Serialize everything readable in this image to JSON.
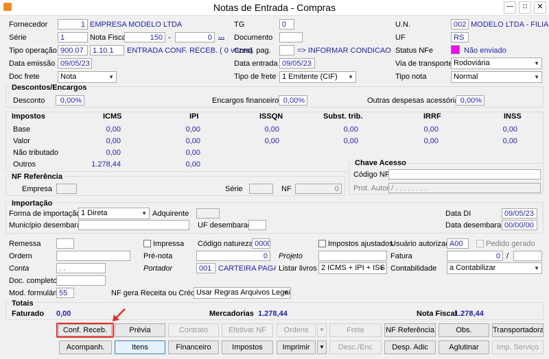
{
  "window": {
    "title": "Notas de Entrada - Compras",
    "app_icon": "orange-app-icon"
  },
  "header": {
    "fornecedor_label": "Fornecedor",
    "fornecedor_code": "1",
    "fornecedor_name": "EMPRESA MODELO LTDA",
    "serie_label": "Série",
    "serie_value": "1",
    "nota_fiscal_label": "Nota Fiscal",
    "nota_fiscal_value": "150",
    "nota_dash": "-",
    "nota_suffix": "0",
    "nota_ellipsis": "...",
    "tipo_operacao_label": "Tipo operação",
    "tipo_operacao_code": "900.07",
    "tipo_operacao_cfop": "1.10.1",
    "tipo_operacao_desc": "ENTRADA CONF. RECEB. ( 0 vezes)",
    "data_emissao_label": "Data emissão",
    "data_emissao_value": "09/05/23",
    "doc_frete_label": "Doc frete",
    "doc_frete_value": "Nota",
    "tg_label": "TG",
    "tg_value": "0",
    "documento_label": "Documento",
    "documento_value": "",
    "cond_pag_label": "Cond. pag.",
    "cond_pag_value": "",
    "cond_pag_hint": "=> INFORMAR CONDICAO DE PA",
    "data_entrada_label": "Data entrada",
    "data_entrada_value": "09/05/23",
    "tipo_frete_label": "Tipo de frete",
    "tipo_frete_value": "1 Emitente (CIF)",
    "un_label": "U.N.",
    "un_code": "002",
    "un_name": "MODELO LTDA - FILIAL",
    "uf_label": "UF",
    "uf_value": "RS",
    "status_nfe_label": "Status NFe",
    "status_nfe_color": "#ff00ff",
    "status_nfe_value": "Não enviado",
    "via_transporte_label": "Via de transporte",
    "via_transporte_value": "Rodoviária",
    "tipo_nota_label": "Tipo nota",
    "tipo_nota_value": "Normal"
  },
  "descontos": {
    "title": "Descontos/Encargos",
    "desconto_label": "Desconto",
    "desconto_value": "0,00%",
    "encargos_label": "Encargos financeiros",
    "encargos_value": "0,00%",
    "outras_label": "Outras despesas acessórias",
    "outras_value": "0,00%"
  },
  "impostos": {
    "title": "Impostos",
    "columns": [
      "ICMS",
      "IPI",
      "ISSQN",
      "Subst. trib.",
      "IRRF",
      "INSS"
    ],
    "rows": [
      {
        "label": "Base",
        "icms": "0,00",
        "ipi": "0,00",
        "issqn": "0,00",
        "subst": "0,00",
        "irrf": "0,00",
        "inss": "0,00"
      },
      {
        "label": "Valor",
        "icms": "0,00",
        "ipi": "0,00",
        "issqn": "0,00",
        "subst": "0,00",
        "irrf": "0,00",
        "inss": "0,00"
      },
      {
        "label": "Não tributado",
        "icms": "0,00",
        "ipi": "0,00"
      },
      {
        "label": "Outros",
        "icms": "1.278,44",
        "ipi": "0,00"
      }
    ]
  },
  "chave": {
    "title": "Chave Acesso",
    "codigo_label": "Código NFe",
    "codigo_value": "",
    "prot_label": "Prot. Autor.",
    "prot_value": "/ . . . . . . . ."
  },
  "nf_ref": {
    "title": "NF Referência",
    "empresa_label": "Empresa",
    "serie_label": "Série",
    "nf_label": "NF",
    "nf_value": "0"
  },
  "importacao": {
    "title": "Importação",
    "forma_label": "Forma de importação",
    "forma_value": "1 Direta",
    "adquirente_label": "Adquirente",
    "municipio_label": "Município desembaraço",
    "uf_label": "UF desembaraço",
    "data_di_label": "Data DI",
    "data_di_value": "09/05/23",
    "data_desemb_label": "Data desembaraço",
    "data_desemb_value": "00/00/00"
  },
  "misc": {
    "remessa_label": "Remessa",
    "impressa_label": "Impressa",
    "codigo_natureza_label": "Código natureza",
    "codigo_natureza_value": "0000",
    "impostos_ajustados_label": "Impostos ajustados",
    "usuario_label": "Usuário autorizado",
    "usuario_value": "A00",
    "pedido_gerado_label": "Pedido gerado",
    "ordem_label": "Ordem",
    "pre_nota_label": "Pré-nota",
    "pre_nota_value": "0",
    "projeto_label": "Projeto",
    "fatura_label": "Fatura",
    "fatura_value": "0",
    "fatura_sep": "/",
    "conta_label": "Conta",
    "conta_value": ". .",
    "portador_label": "Portador",
    "portador_code": "001",
    "portador_name": "CARTEIRA PAGAMI",
    "listar_livros_label": "Listar livros",
    "listar_livros_value": "2 ICMS + IPI + ISS",
    "contabilidade_label": "Contabilidade",
    "contabilidade_value": "a Contabilizar",
    "doc_completo_label": "Doc. completo",
    "mod_formulario_label": "Mod. formulário",
    "mod_formulario_value": "55",
    "nf_gera_label": "NF gera Receita ou Crédito",
    "nf_gera_value": "Usar Regras Arquivos Legais"
  },
  "totais": {
    "title": "Totais",
    "faturado_label": "Faturado",
    "faturado_value": "0,00",
    "mercadorias_label": "Mercadorias",
    "mercadorias_value": "1.278,44",
    "nota_fiscal_label": "Nota Fiscal",
    "nota_fiscal_value": "1.278,44"
  },
  "buttons": {
    "conf_receb": "Conf. Receb.",
    "previa": "Prévia",
    "contrato": "Contrato",
    "efetivar_nf": "Efetivar NF",
    "ordens": "Ordens",
    "frete": "Frete",
    "nf_referencia": "NF Referência",
    "obs": "Obs.",
    "transportadora": "Transportadora",
    "acompanh": "Acompanh.",
    "itens": "Itens",
    "financeiro": "Financeiro",
    "impostos": "Impostos",
    "imprimir": "Imprimir",
    "desc_enc": "Desc./Enc",
    "desp_adic": "Desp. Adic",
    "aglutinar": "Aglutinar",
    "imp_servico": "Imp. Serviço"
  },
  "colors": {
    "highlight": "#e0302a",
    "link_blue": "#1f1fa8"
  }
}
